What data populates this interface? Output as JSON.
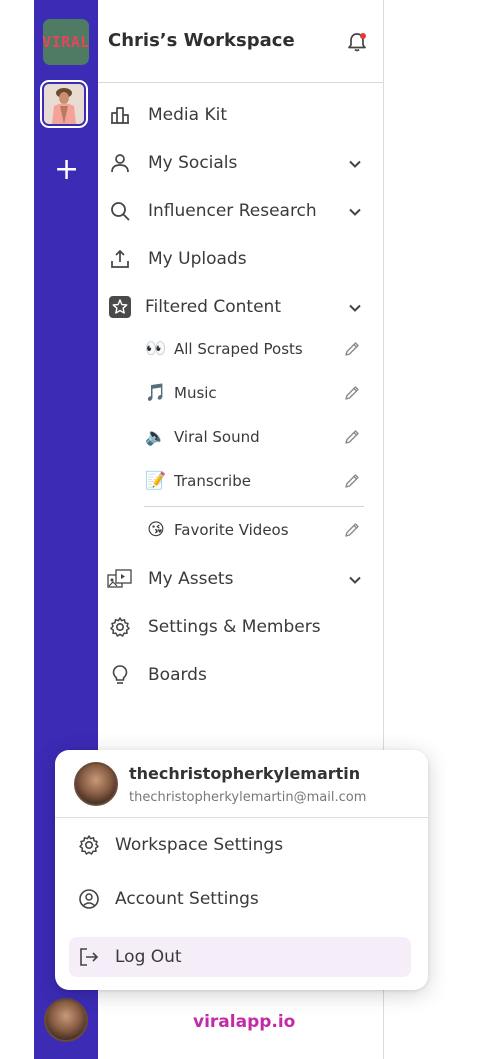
{
  "rail": {
    "logo_text": "VIRAL",
    "add_symbol": "+"
  },
  "workspace": {
    "title": "Chris’s Workspace"
  },
  "nav": {
    "media_kit": "Media Kit",
    "my_socials": "My Socials",
    "influencer_research": "Influencer Research",
    "my_uploads": "My Uploads",
    "filtered_content": "Filtered Content",
    "my_assets": "My Assets",
    "settings_members": "Settings & Members",
    "boards": "Boards"
  },
  "filtered": {
    "items": [
      {
        "emoji": "👀",
        "label": "All Scraped Posts"
      },
      {
        "emoji": "🎵",
        "label": "Music"
      },
      {
        "emoji": "🔈",
        "label": "Viral Sound"
      },
      {
        "emoji": "📝",
        "label": "Transcribe"
      },
      {
        "emoji": "😘",
        "label": "Favorite Videos"
      }
    ]
  },
  "menu": {
    "username": "thechristopherkylemartin",
    "email": "thechristopherkylemartin@mail.com",
    "workspace_settings": "Workspace Settings",
    "account_settings": "Account Settings",
    "log_out": "Log Out"
  },
  "brand": "viralapp.io",
  "colors": {
    "rail": "#3b2bb5",
    "brand": "#c22aa6",
    "active_row": "#f5eef8"
  }
}
